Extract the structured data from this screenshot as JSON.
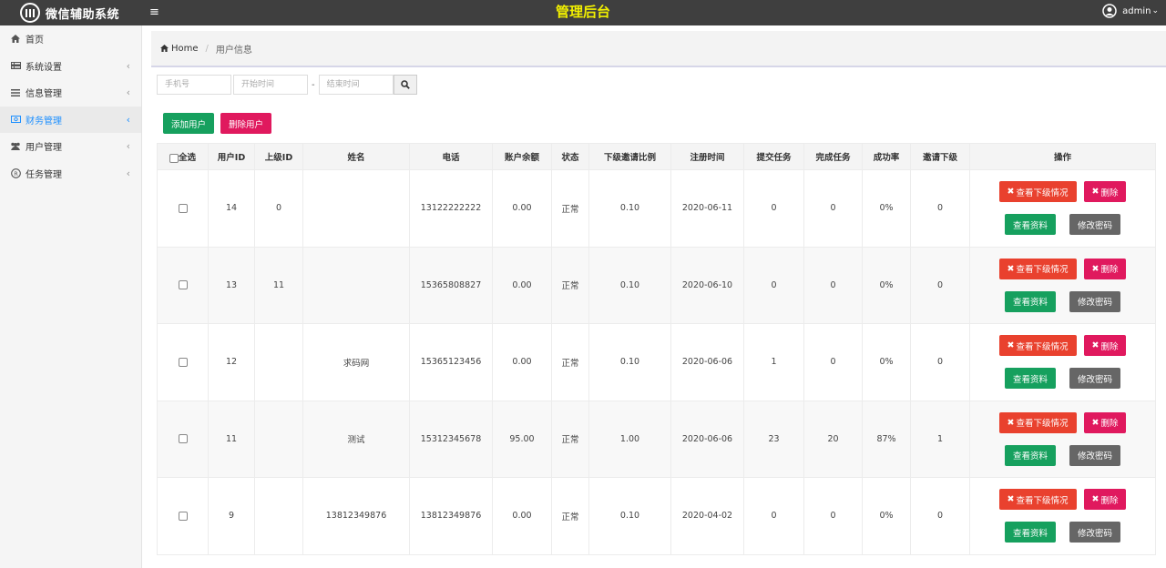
{
  "app": {
    "logo_text": "微信辅助系统",
    "top_title": "管理后台",
    "user_name": "admin"
  },
  "sidebar": {
    "items": [
      {
        "label": "首页",
        "icon": "home-icon",
        "active": false,
        "has_chevron": false
      },
      {
        "label": "系统设置",
        "icon": "list-icon",
        "active": false,
        "has_chevron": true
      },
      {
        "label": "信息管理",
        "icon": "bars-icon",
        "active": false,
        "has_chevron": true
      },
      {
        "label": "财务管理",
        "icon": "money-icon",
        "active": true,
        "has_chevron": true
      },
      {
        "label": "用户管理",
        "icon": "users-icon",
        "active": false,
        "has_chevron": true
      },
      {
        "label": "任务管理",
        "icon": "registered-icon",
        "active": false,
        "has_chevron": true
      }
    ]
  },
  "breadcrumb": {
    "home": "Home",
    "current": "用户信息"
  },
  "search": {
    "phone_placeholder": "手机号",
    "start_placeholder": "开始时间",
    "end_placeholder": "结束时间",
    "range_sep": "-"
  },
  "actions": {
    "add_user": "添加用户",
    "delete_user": "删除用户"
  },
  "table": {
    "headers": [
      "全选",
      "用户ID",
      "上级ID",
      "姓名",
      "电话",
      "账户余额",
      "状态",
      "下级邀请比例",
      "注册时间",
      "提交任务",
      "完成任务",
      "成功率",
      "邀请下级",
      "操作"
    ],
    "rows": [
      {
        "id": "14",
        "parent": "0",
        "name": "",
        "phone": "13122222222",
        "balance": "0.00",
        "status": "正常",
        "ratio": "0.10",
        "date": "2020-06-11",
        "submitted": "0",
        "completed": "0",
        "rate": "0%",
        "invites": "0"
      },
      {
        "id": "13",
        "parent": "11",
        "name": "",
        "phone": "15365808827",
        "balance": "0.00",
        "status": "正常",
        "ratio": "0.10",
        "date": "2020-06-10",
        "submitted": "0",
        "completed": "0",
        "rate": "0%",
        "invites": "0"
      },
      {
        "id": "12",
        "parent": "",
        "name": "求码网",
        "phone": "15365123456",
        "balance": "0.00",
        "status": "正常",
        "ratio": "0.10",
        "date": "2020-06-06",
        "submitted": "1",
        "completed": "0",
        "rate": "0%",
        "invites": "0"
      },
      {
        "id": "11",
        "parent": "",
        "name": "测试",
        "phone": "15312345678",
        "balance": "95.00",
        "status": "正常",
        "ratio": "1.00",
        "date": "2020-06-06",
        "submitted": "23",
        "completed": "20",
        "rate": "87%",
        "invites": "1"
      },
      {
        "id": "9",
        "parent": "",
        "name": "13812349876",
        "phone": "13812349876",
        "balance": "0.00",
        "status": "正常",
        "ratio": "0.10",
        "date": "2020-04-02",
        "submitted": "0",
        "completed": "0",
        "rate": "0%",
        "invites": "0"
      }
    ],
    "row_actions": {
      "view_sub": "查看下级情况",
      "delete": "删除",
      "view_profile": "查看资料",
      "change_password": "修改密码"
    }
  },
  "colors": {
    "topbar": "#3f3f3f",
    "title": "#f2f000",
    "active_link": "#1e90ff",
    "green": "#16a05e",
    "pink": "#e0195e",
    "red": "#e9412e",
    "gray": "#666666"
  }
}
